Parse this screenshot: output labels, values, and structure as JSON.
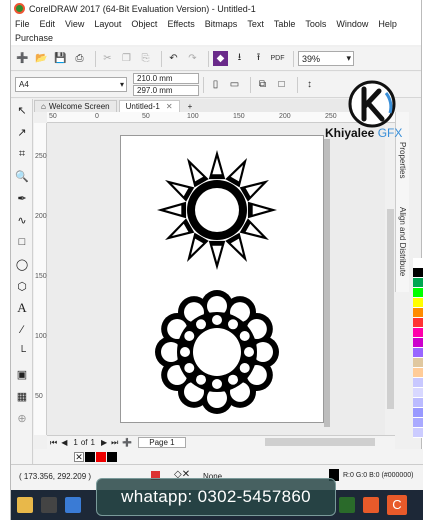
{
  "window": {
    "title": "CorelDRAW 2017 (64-Bit Evaluation Version) - Untitled-1"
  },
  "menu": {
    "row1": [
      "File",
      "Edit",
      "View",
      "Layout",
      "Object",
      "Effects",
      "Bitmaps",
      "Text",
      "Table",
      "Tools",
      "Window",
      "Help"
    ],
    "row2": [
      "Purchase"
    ]
  },
  "toolbar": {
    "zoom_value": "39%"
  },
  "property_bar": {
    "page_size": "A4",
    "width": "210.0 mm",
    "height": "297.0 mm"
  },
  "tabs": {
    "welcome": "Welcome Screen",
    "document": "Untitled-1",
    "add": "+"
  },
  "ruler": {
    "h_labels": [
      "50",
      "0",
      "50",
      "100",
      "150",
      "200",
      "250"
    ],
    "v_labels": [
      "250",
      "200",
      "150",
      "100",
      "50"
    ]
  },
  "dockers": {
    "properties": "Properties",
    "align": "Align and Distribute"
  },
  "page_nav": {
    "current": "1",
    "of_label": "of",
    "total": "1",
    "page_tab": "Page 1"
  },
  "status": {
    "coords": "( 173.356, 292.209 )",
    "fill_label": "None",
    "color_info": "R:0 G:0 B:0 (#000000)"
  },
  "watermark": {
    "brand": "Khiyalee",
    "brand_suffix": "GFX",
    "contact": "whatapp: 0302-5457860"
  },
  "colors": {
    "palette": [
      "#ffffff",
      "#000000",
      "#00a651",
      "#00ff00",
      "#ffff00",
      "#ff8c00",
      "#ff3333",
      "#ff00aa",
      "#cc00cc",
      "#9966ff",
      "#e0c8a0",
      "#ffcc99",
      "#c8c8ff",
      "#d8d8ff",
      "#bbbbff",
      "#9999ff",
      "#aaaaff",
      "#ccccff"
    ]
  }
}
